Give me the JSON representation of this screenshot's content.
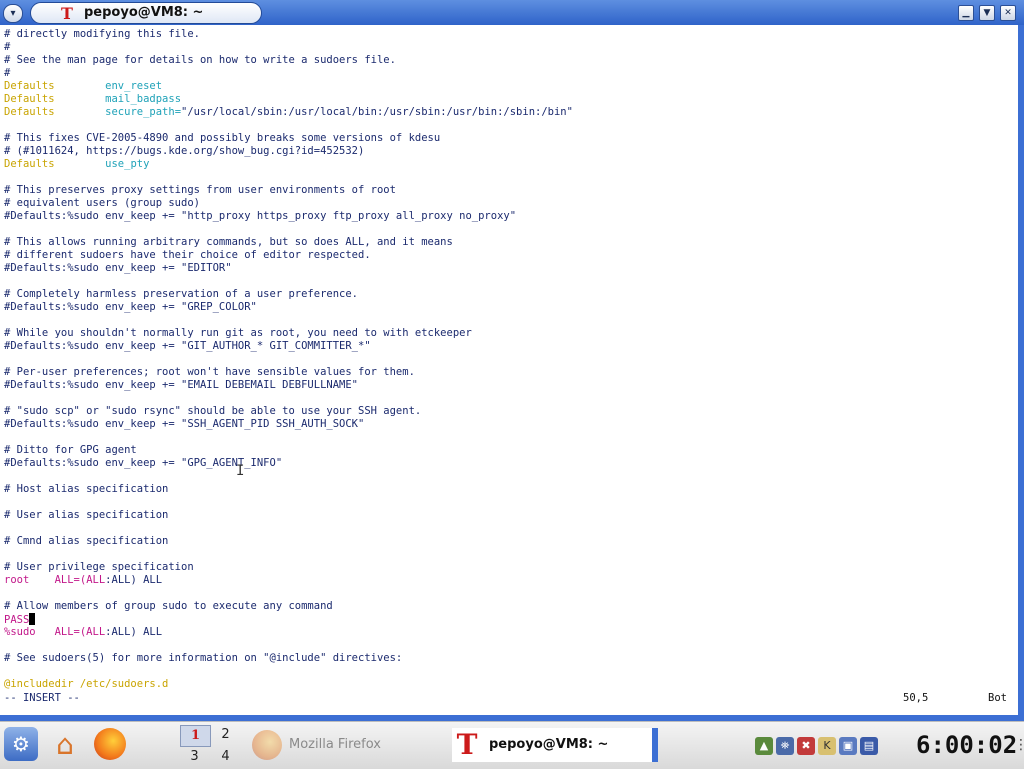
{
  "window": {
    "title": "pepoyo@VM8: ~",
    "menu_glyph": "▾",
    "app_glyph": "T",
    "buttons": {
      "minimize": "▁",
      "shade": "▼",
      "close": "✕"
    }
  },
  "editor": {
    "lines": [
      {
        "t": "# directly modifying this file."
      },
      {
        "t": "#"
      },
      {
        "t": "# See the man page for details on how to write a sudoers file."
      },
      {
        "t": "#"
      },
      {
        "kw": "Defaults",
        "pad": "        ",
        "val": "env_reset"
      },
      {
        "kw": "Defaults",
        "pad": "        ",
        "val": "mail_badpass"
      },
      {
        "kw": "Defaults",
        "pad": "        ",
        "val": "secure_path=",
        "str": "\"/usr/local/sbin:/usr/local/bin:/usr/sbin:/usr/bin:/sbin:/bin\""
      },
      {
        "t": ""
      },
      {
        "t": "# This fixes CVE-2005-4890 and possibly breaks some versions of kdesu"
      },
      {
        "t": "# (#1011624, https://bugs.kde.org/show_bug.cgi?id=452532)"
      },
      {
        "kw": "Defaults",
        "pad": "        ",
        "val": "use_pty"
      },
      {
        "t": ""
      },
      {
        "t": "# This preserves proxy settings from user environments of root"
      },
      {
        "t": "# equivalent users (group sudo)"
      },
      {
        "t": "#Defaults:%sudo env_keep += \"http_proxy https_proxy ftp_proxy all_proxy no_proxy\""
      },
      {
        "t": ""
      },
      {
        "t": "# This allows running arbitrary commands, but so does ALL, and it means"
      },
      {
        "t": "# different sudoers have their choice of editor respected."
      },
      {
        "t": "#Defaults:%sudo env_keep += \"EDITOR\""
      },
      {
        "t": ""
      },
      {
        "t": "# Completely harmless preservation of a user preference."
      },
      {
        "t": "#Defaults:%sudo env_keep += \"GREP_COLOR\""
      },
      {
        "t": ""
      },
      {
        "t": "# While you shouldn't normally run git as root, you need to with etckeeper"
      },
      {
        "t": "#Defaults:%sudo env_keep += \"GIT_AUTHOR_* GIT_COMMITTER_*\""
      },
      {
        "t": ""
      },
      {
        "t": "# Per-user preferences; root won't have sensible values for them."
      },
      {
        "t": "#Defaults:%sudo env_keep += \"EMAIL DEBEMAIL DEBFULLNAME\""
      },
      {
        "t": ""
      },
      {
        "t": "# \"sudo scp\" or \"sudo rsync\" should be able to use your SSH agent."
      },
      {
        "t": "#Defaults:%sudo env_keep += \"SSH_AGENT_PID SSH_AUTH_SOCK\""
      },
      {
        "t": ""
      },
      {
        "t": "# Ditto for GPG agent"
      },
      {
        "t": "#Defaults:%sudo env_keep += \"GPG_AGENT_INFO\""
      },
      {
        "t": ""
      },
      {
        "t": "# Host alias specification"
      },
      {
        "t": ""
      },
      {
        "t": "# User alias specification"
      },
      {
        "t": ""
      },
      {
        "t": "# Cmnd alias specification"
      },
      {
        "t": ""
      },
      {
        "t": "# User privilege specification"
      },
      {
        "rule": "root",
        "pad": "    ",
        "a": "ALL=(ALL",
        "b": ":ALL) ALL"
      },
      {
        "t": ""
      },
      {
        "t": "# Allow members of group sudo to execute any command"
      },
      {
        "pass": "PASS"
      },
      {
        "rule": "%sudo",
        "pad": "   ",
        "a": "ALL=(ALL",
        "b": ":ALL) ALL"
      },
      {
        "t": ""
      },
      {
        "t": "# See sudoers(5) for more information on \"@include\" directives:"
      },
      {
        "t": ""
      },
      {
        "inc": "@includedir /etc/sudoers.d"
      }
    ],
    "mode": "-- INSERT --",
    "position": "50,5",
    "scroll": "Bot"
  },
  "taskbar": {
    "kmenu_glyph": "⚙",
    "home_glyph": "⌂",
    "pager": [
      "1",
      "2",
      "3",
      "4"
    ],
    "tasks": [
      {
        "label": "Mozilla Firefox"
      },
      {
        "label": "pepoyo@VM8: ~",
        "glyph": "T"
      }
    ],
    "tray": [
      "▲",
      "⛯",
      "✖",
      "K",
      "▣",
      "▤"
    ],
    "clock": "6:00:02"
  }
}
